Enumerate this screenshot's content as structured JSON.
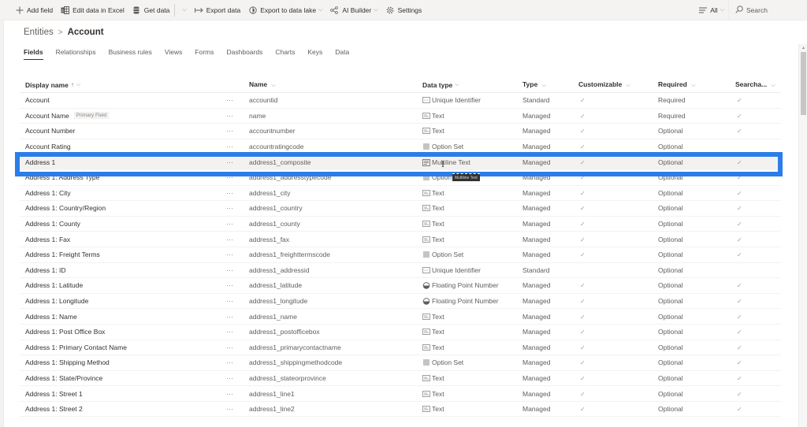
{
  "command_bar": {
    "items": [
      {
        "label": "Add field",
        "icon": "plus-icon"
      },
      {
        "label": "Edit data in Excel",
        "icon": "excel-icon"
      },
      {
        "label": "Get data",
        "icon": "database-icon",
        "has_dropdown": true
      },
      {
        "label": "Export data",
        "icon": "export-arrow-icon"
      },
      {
        "label": "Export to data lake",
        "icon": "data-lake-icon",
        "has_dropdown": true
      },
      {
        "label": "AI Builder",
        "icon": "ai-builder-icon",
        "has_dropdown": true
      },
      {
        "label": "Settings",
        "icon": "gear-icon"
      }
    ],
    "filter_label": "All",
    "search_placeholder": "Search"
  },
  "breadcrumb": {
    "parent": "Entities",
    "current": "Account"
  },
  "tabs": [
    {
      "label": "Fields",
      "active": true
    },
    {
      "label": "Relationships"
    },
    {
      "label": "Business rules"
    },
    {
      "label": "Views"
    },
    {
      "label": "Forms"
    },
    {
      "label": "Dashboards"
    },
    {
      "label": "Charts"
    },
    {
      "label": "Keys"
    },
    {
      "label": "Data"
    }
  ],
  "table": {
    "columns": {
      "display_name": "Display name",
      "name": "Name",
      "data_type": "Data type",
      "type": "Type",
      "customizable": "Customizable",
      "required": "Required",
      "searchable": "Searcha..."
    },
    "sort_indicator": "↑",
    "more_glyph": "···",
    "check_glyph": "✓",
    "rows": [
      {
        "display": "Account",
        "badge": "",
        "name": "accountid",
        "data_type": "Unique Identifier",
        "dt_icon": "unique-identifier",
        "type": "Standard",
        "customizable": true,
        "required": "Required",
        "searchable": true
      },
      {
        "display": "Account Name",
        "badge": "Primary Field",
        "name": "name",
        "data_type": "Text",
        "dt_icon": "text",
        "type": "Managed",
        "customizable": true,
        "required": "Required",
        "searchable": true
      },
      {
        "display": "Account Number",
        "badge": "",
        "name": "accountnumber",
        "data_type": "Text",
        "dt_icon": "text",
        "type": "Managed",
        "customizable": true,
        "required": "Optional",
        "searchable": true
      },
      {
        "display": "Account Rating",
        "badge": "",
        "name": "accountratingcode",
        "data_type": "Option Set",
        "dt_icon": "option-set",
        "type": "Managed",
        "customizable": true,
        "required": "Optional",
        "searchable": false
      },
      {
        "display": "Address 1",
        "badge": "",
        "name": "address1_composite",
        "data_type": "Multiline Text",
        "dt_icon": "multiline-text",
        "type": "Managed",
        "customizable": true,
        "required": "Optional",
        "searchable": true,
        "selected": true
      },
      {
        "display": "Address 1: Address Type",
        "badge": "",
        "name": "address1_addresstypecode",
        "data_type": "Option Set",
        "dt_icon": "option-set",
        "type": "Managed",
        "customizable": true,
        "required": "Optional",
        "searchable": true
      },
      {
        "display": "Address 1: City",
        "badge": "",
        "name": "address1_city",
        "data_type": "Text",
        "dt_icon": "text",
        "type": "Managed",
        "customizable": true,
        "required": "Optional",
        "searchable": true
      },
      {
        "display": "Address 1: Country/Region",
        "badge": "",
        "name": "address1_country",
        "data_type": "Text",
        "dt_icon": "text",
        "type": "Managed",
        "customizable": true,
        "required": "Optional",
        "searchable": true
      },
      {
        "display": "Address 1: County",
        "badge": "",
        "name": "address1_county",
        "data_type": "Text",
        "dt_icon": "text",
        "type": "Managed",
        "customizable": true,
        "required": "Optional",
        "searchable": true
      },
      {
        "display": "Address 1: Fax",
        "badge": "",
        "name": "address1_fax",
        "data_type": "Text",
        "dt_icon": "text",
        "type": "Managed",
        "customizable": true,
        "required": "Optional",
        "searchable": true
      },
      {
        "display": "Address 1: Freight Terms",
        "badge": "",
        "name": "address1_freighttermscode",
        "data_type": "Option Set",
        "dt_icon": "option-set",
        "type": "Managed",
        "customizable": true,
        "required": "Optional",
        "searchable": true
      },
      {
        "display": "Address 1: ID",
        "badge": "",
        "name": "address1_addressid",
        "data_type": "Unique Identifier",
        "dt_icon": "unique-identifier",
        "type": "Standard",
        "customizable": false,
        "required": "Optional",
        "searchable": false
      },
      {
        "display": "Address 1: Latitude",
        "badge": "",
        "name": "address1_latitude",
        "data_type": "Floating Point Number",
        "dt_icon": "floating-point",
        "type": "Managed",
        "customizable": true,
        "required": "Optional",
        "searchable": true
      },
      {
        "display": "Address 1: Longitude",
        "badge": "",
        "name": "address1_longitude",
        "data_type": "Floating Point Number",
        "dt_icon": "floating-point",
        "type": "Managed",
        "customizable": true,
        "required": "Optional",
        "searchable": true
      },
      {
        "display": "Address 1: Name",
        "badge": "",
        "name": "address1_name",
        "data_type": "Text",
        "dt_icon": "text",
        "type": "Managed",
        "customizable": true,
        "required": "Optional",
        "searchable": true
      },
      {
        "display": "Address 1: Post Office Box",
        "badge": "",
        "name": "address1_postofficebox",
        "data_type": "Text",
        "dt_icon": "text",
        "type": "Managed",
        "customizable": true,
        "required": "Optional",
        "searchable": true
      },
      {
        "display": "Address 1: Primary Contact Name",
        "badge": "",
        "name": "address1_primarycontactname",
        "data_type": "Text",
        "dt_icon": "text",
        "type": "Managed",
        "customizable": true,
        "required": "Optional",
        "searchable": true
      },
      {
        "display": "Address 1: Shipping Method",
        "badge": "",
        "name": "address1_shippingmethodcode",
        "data_type": "Option Set",
        "dt_icon": "option-set",
        "type": "Managed",
        "customizable": true,
        "required": "Optional",
        "searchable": true
      },
      {
        "display": "Address 1: State/Province",
        "badge": "",
        "name": "address1_stateorprovince",
        "data_type": "Text",
        "dt_icon": "text",
        "type": "Managed",
        "customizable": true,
        "required": "Optional",
        "searchable": true
      },
      {
        "display": "Address 1: Street 1",
        "badge": "",
        "name": "address1_line1",
        "data_type": "Text",
        "dt_icon": "text",
        "type": "Managed",
        "customizable": true,
        "required": "Optional",
        "searchable": true
      },
      {
        "display": "Address 1: Street 2",
        "badge": "",
        "name": "address1_line2",
        "data_type": "Text",
        "dt_icon": "text",
        "type": "Managed",
        "customizable": true,
        "required": "Optional",
        "searchable": true
      }
    ]
  },
  "tooltip": {
    "text": "Multiline Text"
  },
  "colors": {
    "selection_outline": "#2b7de9",
    "command_bar_bg": "#f4f3f2"
  }
}
